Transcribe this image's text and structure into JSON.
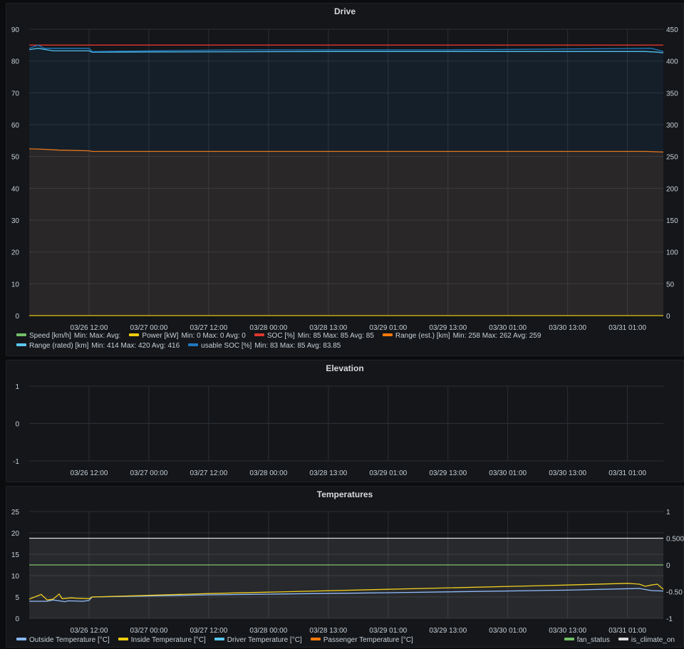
{
  "colors": {
    "grid": "#2c2f34",
    "tick": "#c7d0d9",
    "green": "#73bf69",
    "yellow": "#f2cc0c",
    "red": "#e0372f",
    "orange": "#ff780a",
    "lightblue": "#5ac8f0",
    "blue": "#1f78c1",
    "periwinkle": "#8ab8ff",
    "white": "#d8d9da"
  },
  "x_ticks": [
    "03/26 12:00",
    "03/27 00:00",
    "03/27 12:00",
    "03/28 00:00",
    "03/28 13:00",
    "03/29 01:00",
    "03/29 13:00",
    "03/30 01:00",
    "03/30 13:00",
    "03/31 01:00"
  ],
  "drive": {
    "title": "Drive",
    "legend": [
      {
        "label": "Speed [km/h]",
        "stats": "Min:  Max:  Avg:",
        "color": "green"
      },
      {
        "label": "Power [kW]",
        "stats": "Min: 0  Max: 0  Avg: 0",
        "color": "yellow"
      },
      {
        "label": "SOC [%]",
        "stats": "Min: 85  Max: 85  Avg: 85",
        "color": "red"
      },
      {
        "label": "Range (est.) [km]",
        "stats": "Min: 258  Max: 262  Avg: 259",
        "color": "orange"
      },
      {
        "label": "Range (rated) [km]",
        "stats": "Min: 414  Max: 420  Avg: 416",
        "color": "lightblue"
      },
      {
        "label": "usable SOC [%]",
        "stats": "Min: 83  Max: 85  Avg: 83.85",
        "color": "blue"
      }
    ]
  },
  "elevation": {
    "title": "Elevation"
  },
  "temperatures": {
    "title": "Temperatures",
    "legend_left": [
      {
        "label": "Outside Temperature [°C]",
        "color": "periwinkle"
      },
      {
        "label": "Inside Temperature [°C]",
        "color": "yellow"
      },
      {
        "label": "Driver Temperature [°C]",
        "color": "lightblue"
      },
      {
        "label": "Passenger Temperature [°C]",
        "color": "orange"
      }
    ],
    "legend_right": [
      {
        "label": "fan_status",
        "color": "green"
      },
      {
        "label": "is_climate_on",
        "color": "white"
      }
    ]
  },
  "chart_data": [
    {
      "type": "line",
      "title": "Drive",
      "x_index_range": [
        0,
        10.6
      ],
      "x_tick_index": [
        1,
        2,
        3,
        4,
        5,
        6,
        7,
        8,
        9,
        10
      ],
      "ylim_left": [
        0,
        90
      ],
      "yticks_left": [
        0,
        10,
        20,
        30,
        40,
        50,
        60,
        70,
        80,
        90
      ],
      "ylim_right": [
        0,
        450
      ],
      "yticks_right": [
        0,
        50,
        100,
        150,
        200,
        250,
        300,
        350,
        400,
        450
      ],
      "grid": true,
      "legend_position": "bottom",
      "series": [
        {
          "name": "Speed [km/h]",
          "color": "green",
          "axis": "left",
          "x": [],
          "y": []
        },
        {
          "name": "Power [kW]",
          "color": "yellow",
          "axis": "left",
          "x": [
            0,
            10.6
          ],
          "y": [
            0,
            0
          ]
        },
        {
          "name": "SOC [%]",
          "color": "red",
          "axis": "left",
          "x": [
            0,
            10.6
          ],
          "y": [
            85,
            85
          ]
        },
        {
          "name": "Range (est.) [km]",
          "color": "orange",
          "axis": "right",
          "fill": true,
          "x": [
            0,
            0.2,
            0.5,
            1.0,
            1.05,
            3.5,
            7.0,
            10.3,
            10.6
          ],
          "y": [
            262,
            261.5,
            260,
            259,
            258,
            258,
            258,
            258,
            257
          ]
        },
        {
          "name": "Range (rated) [km]",
          "color": "lightblue",
          "axis": "right",
          "x": [
            0,
            0.15,
            0.4,
            1.0,
            1.05,
            5.0,
            10.3,
            10.5,
            10.6
          ],
          "y": [
            418,
            420,
            416,
            416,
            414,
            415,
            415,
            414,
            413
          ]
        },
        {
          "name": "usable SOC [%]",
          "color": "blue",
          "axis": "left",
          "fill": true,
          "x": [
            0,
            0.15,
            0.25,
            1.0,
            1.05,
            3.5,
            7.0,
            10.4,
            10.6
          ],
          "y": [
            84,
            85,
            84,
            84,
            83,
            83.5,
            83.5,
            84,
            83
          ]
        }
      ]
    },
    {
      "type": "line",
      "title": "Elevation",
      "x_index_range": [
        0,
        10.6
      ],
      "x_tick_index": [
        1,
        2,
        3,
        4,
        5,
        6,
        7,
        8,
        9,
        10
      ],
      "ylim_left": [
        -1,
        1
      ],
      "yticks_left": [
        -1,
        0,
        1
      ],
      "grid": true,
      "series": []
    },
    {
      "type": "line",
      "title": "Temperatures",
      "x_index_range": [
        0,
        10.6
      ],
      "x_tick_index": [
        1,
        2,
        3,
        4,
        5,
        6,
        7,
        8,
        9,
        10
      ],
      "ylim_left": [
        0,
        25
      ],
      "yticks_left": [
        0,
        5,
        10,
        15,
        20,
        25
      ],
      "ylim_right": [
        -1,
        1
      ],
      "yticks_right": [
        -1,
        -0.5,
        0,
        0.5,
        1
      ],
      "ytick_labels_right": [
        "-1",
        "-0.50",
        "0",
        "0.500",
        "1"
      ],
      "grid": true,
      "legend_position": "bottom",
      "series": [
        {
          "name": "Outside Temperature [°C]",
          "color": "periwinkle",
          "axis": "left",
          "x": [
            0,
            0.3,
            0.4,
            0.6,
            0.65,
            0.9,
            1.0,
            1.05,
            3.0,
            6.0,
            9.0,
            10.2,
            10.4,
            10.6
          ],
          "y": [
            4,
            4,
            4.3,
            3.9,
            4.1,
            4.0,
            4.2,
            5.0,
            5.5,
            6.0,
            6.6,
            7.0,
            6.5,
            6.4
          ]
        },
        {
          "name": "Inside Temperature [°C]",
          "color": "yellow",
          "axis": "left",
          "x": [
            0,
            0.2,
            0.3,
            0.4,
            0.5,
            0.55,
            0.7,
            0.8,
            1.0,
            1.05,
            3.0,
            6.0,
            9.0,
            10.0,
            10.2,
            10.3,
            10.4,
            10.5,
            10.6
          ],
          "y": [
            4.5,
            5.6,
            4.3,
            4.5,
            5.7,
            4.6,
            4.8,
            4.7,
            4.6,
            5.0,
            5.8,
            6.8,
            7.8,
            8.2,
            8.0,
            7.5,
            7.8,
            8.0,
            6.8
          ]
        },
        {
          "name": "Driver Temperature [°C]",
          "color": "lightblue",
          "axis": "left",
          "x": [],
          "y": []
        },
        {
          "name": "Passenger Temperature [°C]",
          "color": "orange",
          "axis": "left",
          "x": [],
          "y": []
        },
        {
          "name": "fan_status",
          "color": "green",
          "axis": "right",
          "x": [
            0,
            10.6
          ],
          "y": [
            0,
            0
          ]
        },
        {
          "name": "is_climate_on",
          "color": "white",
          "axis": "right",
          "fill": true,
          "x": [
            0,
            10.6
          ],
          "y": [
            0.5,
            0.5
          ]
        }
      ]
    }
  ]
}
